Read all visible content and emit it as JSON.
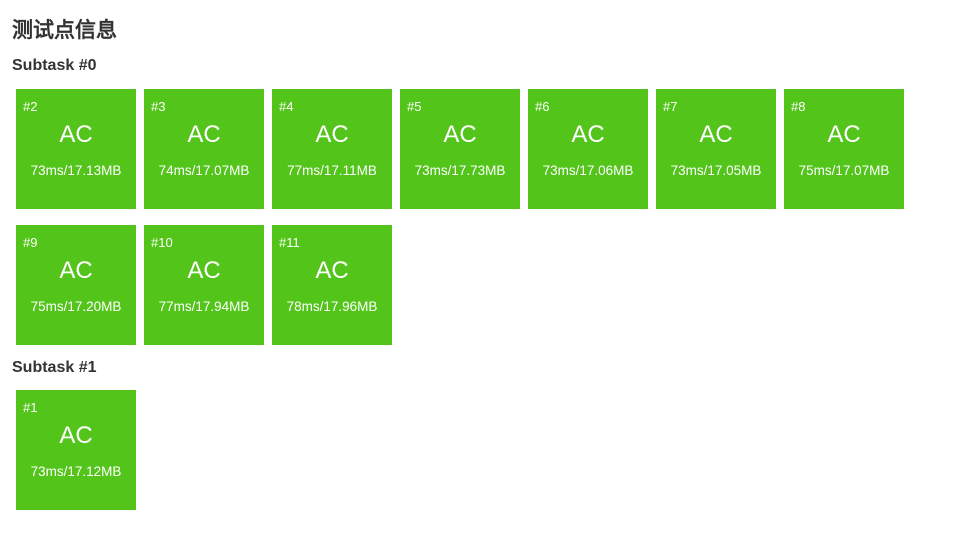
{
  "page": {
    "title": "测试点信息"
  },
  "colors": {
    "accepted": "#52c41a",
    "heading_text": "#333333",
    "tile_text": "#ffffff"
  },
  "subtasks": [
    {
      "heading": "Subtask #0",
      "cases": [
        {
          "id": "#2",
          "status": "AC",
          "stats": "73ms/17.13MB"
        },
        {
          "id": "#3",
          "status": "AC",
          "stats": "74ms/17.07MB"
        },
        {
          "id": "#4",
          "status": "AC",
          "stats": "77ms/17.11MB"
        },
        {
          "id": "#5",
          "status": "AC",
          "stats": "73ms/17.73MB"
        },
        {
          "id": "#6",
          "status": "AC",
          "stats": "73ms/17.06MB"
        },
        {
          "id": "#7",
          "status": "AC",
          "stats": "73ms/17.05MB"
        },
        {
          "id": "#8",
          "status": "AC",
          "stats": "75ms/17.07MB"
        },
        {
          "id": "#9",
          "status": "AC",
          "stats": "75ms/17.20MB"
        },
        {
          "id": "#10",
          "status": "AC",
          "stats": "77ms/17.94MB"
        },
        {
          "id": "#11",
          "status": "AC",
          "stats": "78ms/17.96MB"
        }
      ]
    },
    {
      "heading": "Subtask #1",
      "cases": [
        {
          "id": "#1",
          "status": "AC",
          "stats": "73ms/17.12MB"
        }
      ]
    }
  ]
}
